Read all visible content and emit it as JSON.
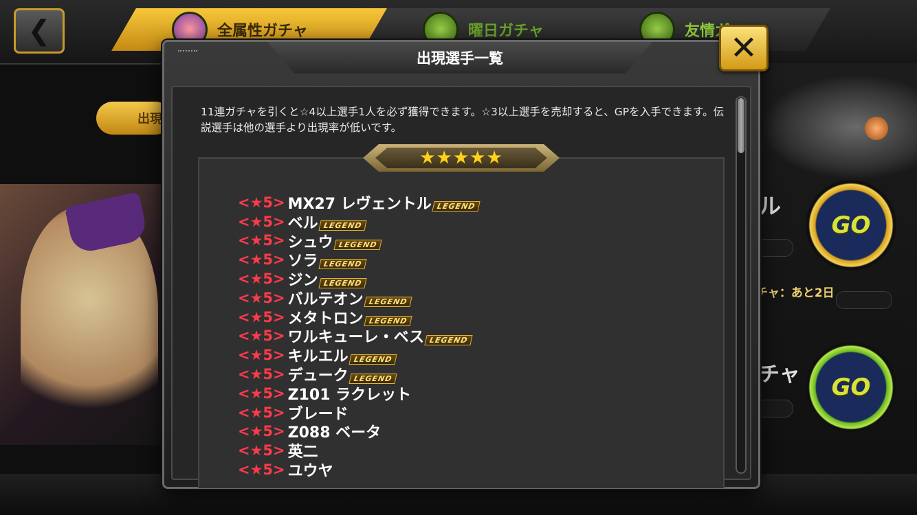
{
  "header": {
    "back_icon": "chevron-left-icon",
    "tabs": [
      {
        "label": "全属性ガチャ",
        "icon": "orbs-icon"
      },
      {
        "label": "曜日ガチャ",
        "icon": "gear-icon"
      },
      {
        "label": "友情ガ",
        "icon": "handshake-icon"
      }
    ]
  },
  "background": {
    "pill_label": "出現",
    "right_label_1": "ル",
    "go_label": "GO",
    "remaining_text": "チャ：あと2日",
    "right_label_2": "チャ",
    "colors": {
      "gold": "#f3c13a",
      "green": "#8ec93a"
    }
  },
  "dialog": {
    "title": "出現選手一覧",
    "description": "11連ガチャを引くと☆4以上選手1人を必ず獲得できます。☆3以上選手を売却すると、GPを入手できます。伝説選手は他の選手より出現率が低いです。",
    "rank_stars": "★★★★★",
    "legend_badge": "LEGEND",
    "close_icon": "close-icon",
    "players": [
      {
        "rank": "<★5>",
        "name": "MX27 レヴェントル",
        "legend": true
      },
      {
        "rank": "<★5>",
        "name": "ベル",
        "legend": true
      },
      {
        "rank": "<★5>",
        "name": "シュウ",
        "legend": true
      },
      {
        "rank": "<★5>",
        "name": "ソラ",
        "legend": true
      },
      {
        "rank": "<★5>",
        "name": "ジン",
        "legend": true
      },
      {
        "rank": "<★5>",
        "name": "バルテオン",
        "legend": true
      },
      {
        "rank": "<★5>",
        "name": "メタトロン",
        "legend": true
      },
      {
        "rank": "<★5>",
        "name": "ワルキューレ・ベス",
        "legend": true
      },
      {
        "rank": "<★5>",
        "name": "キルエル",
        "legend": true
      },
      {
        "rank": "<★5>",
        "name": "デューク",
        "legend": true
      },
      {
        "rank": "<★5>",
        "name": "Z101 ラクレット",
        "legend": false
      },
      {
        "rank": "<★5>",
        "name": "ブレード",
        "legend": false
      },
      {
        "rank": "<★5>",
        "name": "Z088 ベータ",
        "legend": false
      },
      {
        "rank": "<★5>",
        "name": "英二",
        "legend": false
      },
      {
        "rank": "<★5>",
        "name": "ユウヤ",
        "legend": false
      }
    ],
    "colors": {
      "rank": "#ff3a4a",
      "legend_text": "#ffe27a"
    }
  }
}
